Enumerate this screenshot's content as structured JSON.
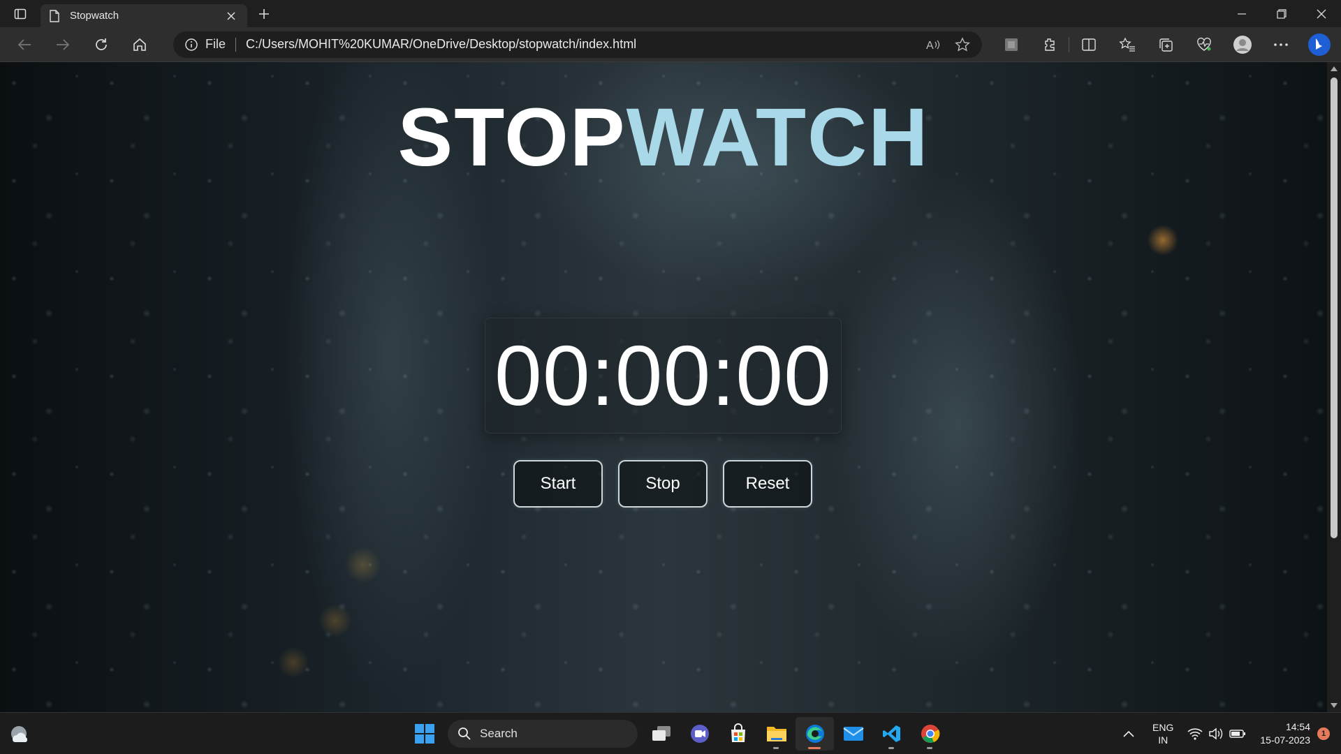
{
  "browser": {
    "tab": {
      "title": "Stopwatch"
    },
    "address": {
      "protocol": "File",
      "url": "C:/Users/MOHIT%20KUMAR/OneDrive/Desktop/stopwatch/index.html"
    }
  },
  "page": {
    "heading_part1": "STOP",
    "heading_part2": "WATCH",
    "time_display": "00:00:00",
    "buttons": {
      "start": "Start",
      "stop": "Stop",
      "reset": "Reset"
    }
  },
  "taskbar": {
    "search_label": "Search",
    "lang_line1": "ENG",
    "lang_line2": "IN",
    "time": "14:54",
    "date": "15-07-2023",
    "notification_count": "1"
  },
  "colors": {
    "heading_accent": "#a9d9e8",
    "notification": "#e57b5a"
  }
}
